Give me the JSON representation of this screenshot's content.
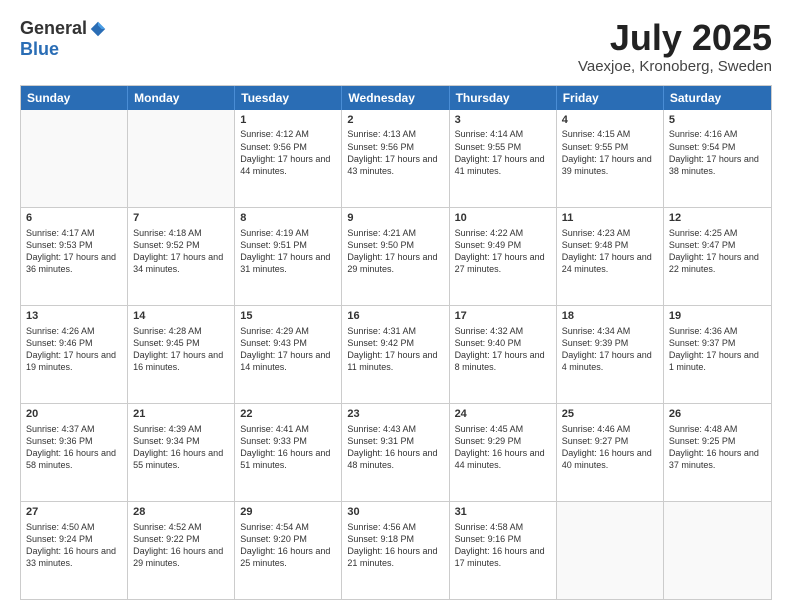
{
  "logo": {
    "general": "General",
    "blue": "Blue"
  },
  "header": {
    "month": "July 2025",
    "location": "Vaexjoe, Kronoberg, Sweden"
  },
  "days": [
    "Sunday",
    "Monday",
    "Tuesday",
    "Wednesday",
    "Thursday",
    "Friday",
    "Saturday"
  ],
  "weeks": [
    [
      {
        "day": "",
        "content": ""
      },
      {
        "day": "",
        "content": ""
      },
      {
        "day": "1",
        "content": "Sunrise: 4:12 AM\nSunset: 9:56 PM\nDaylight: 17 hours and 44 minutes."
      },
      {
        "day": "2",
        "content": "Sunrise: 4:13 AM\nSunset: 9:56 PM\nDaylight: 17 hours and 43 minutes."
      },
      {
        "day": "3",
        "content": "Sunrise: 4:14 AM\nSunset: 9:55 PM\nDaylight: 17 hours and 41 minutes."
      },
      {
        "day": "4",
        "content": "Sunrise: 4:15 AM\nSunset: 9:55 PM\nDaylight: 17 hours and 39 minutes."
      },
      {
        "day": "5",
        "content": "Sunrise: 4:16 AM\nSunset: 9:54 PM\nDaylight: 17 hours and 38 minutes."
      }
    ],
    [
      {
        "day": "6",
        "content": "Sunrise: 4:17 AM\nSunset: 9:53 PM\nDaylight: 17 hours and 36 minutes."
      },
      {
        "day": "7",
        "content": "Sunrise: 4:18 AM\nSunset: 9:52 PM\nDaylight: 17 hours and 34 minutes."
      },
      {
        "day": "8",
        "content": "Sunrise: 4:19 AM\nSunset: 9:51 PM\nDaylight: 17 hours and 31 minutes."
      },
      {
        "day": "9",
        "content": "Sunrise: 4:21 AM\nSunset: 9:50 PM\nDaylight: 17 hours and 29 minutes."
      },
      {
        "day": "10",
        "content": "Sunrise: 4:22 AM\nSunset: 9:49 PM\nDaylight: 17 hours and 27 minutes."
      },
      {
        "day": "11",
        "content": "Sunrise: 4:23 AM\nSunset: 9:48 PM\nDaylight: 17 hours and 24 minutes."
      },
      {
        "day": "12",
        "content": "Sunrise: 4:25 AM\nSunset: 9:47 PM\nDaylight: 17 hours and 22 minutes."
      }
    ],
    [
      {
        "day": "13",
        "content": "Sunrise: 4:26 AM\nSunset: 9:46 PM\nDaylight: 17 hours and 19 minutes."
      },
      {
        "day": "14",
        "content": "Sunrise: 4:28 AM\nSunset: 9:45 PM\nDaylight: 17 hours and 16 minutes."
      },
      {
        "day": "15",
        "content": "Sunrise: 4:29 AM\nSunset: 9:43 PM\nDaylight: 17 hours and 14 minutes."
      },
      {
        "day": "16",
        "content": "Sunrise: 4:31 AM\nSunset: 9:42 PM\nDaylight: 17 hours and 11 minutes."
      },
      {
        "day": "17",
        "content": "Sunrise: 4:32 AM\nSunset: 9:40 PM\nDaylight: 17 hours and 8 minutes."
      },
      {
        "day": "18",
        "content": "Sunrise: 4:34 AM\nSunset: 9:39 PM\nDaylight: 17 hours and 4 minutes."
      },
      {
        "day": "19",
        "content": "Sunrise: 4:36 AM\nSunset: 9:37 PM\nDaylight: 17 hours and 1 minute."
      }
    ],
    [
      {
        "day": "20",
        "content": "Sunrise: 4:37 AM\nSunset: 9:36 PM\nDaylight: 16 hours and 58 minutes."
      },
      {
        "day": "21",
        "content": "Sunrise: 4:39 AM\nSunset: 9:34 PM\nDaylight: 16 hours and 55 minutes."
      },
      {
        "day": "22",
        "content": "Sunrise: 4:41 AM\nSunset: 9:33 PM\nDaylight: 16 hours and 51 minutes."
      },
      {
        "day": "23",
        "content": "Sunrise: 4:43 AM\nSunset: 9:31 PM\nDaylight: 16 hours and 48 minutes."
      },
      {
        "day": "24",
        "content": "Sunrise: 4:45 AM\nSunset: 9:29 PM\nDaylight: 16 hours and 44 minutes."
      },
      {
        "day": "25",
        "content": "Sunrise: 4:46 AM\nSunset: 9:27 PM\nDaylight: 16 hours and 40 minutes."
      },
      {
        "day": "26",
        "content": "Sunrise: 4:48 AM\nSunset: 9:25 PM\nDaylight: 16 hours and 37 minutes."
      }
    ],
    [
      {
        "day": "27",
        "content": "Sunrise: 4:50 AM\nSunset: 9:24 PM\nDaylight: 16 hours and 33 minutes."
      },
      {
        "day": "28",
        "content": "Sunrise: 4:52 AM\nSunset: 9:22 PM\nDaylight: 16 hours and 29 minutes."
      },
      {
        "day": "29",
        "content": "Sunrise: 4:54 AM\nSunset: 9:20 PM\nDaylight: 16 hours and 25 minutes."
      },
      {
        "day": "30",
        "content": "Sunrise: 4:56 AM\nSunset: 9:18 PM\nDaylight: 16 hours and 21 minutes."
      },
      {
        "day": "31",
        "content": "Sunrise: 4:58 AM\nSunset: 9:16 PM\nDaylight: 16 hours and 17 minutes."
      },
      {
        "day": "",
        "content": ""
      },
      {
        "day": "",
        "content": ""
      }
    ]
  ]
}
